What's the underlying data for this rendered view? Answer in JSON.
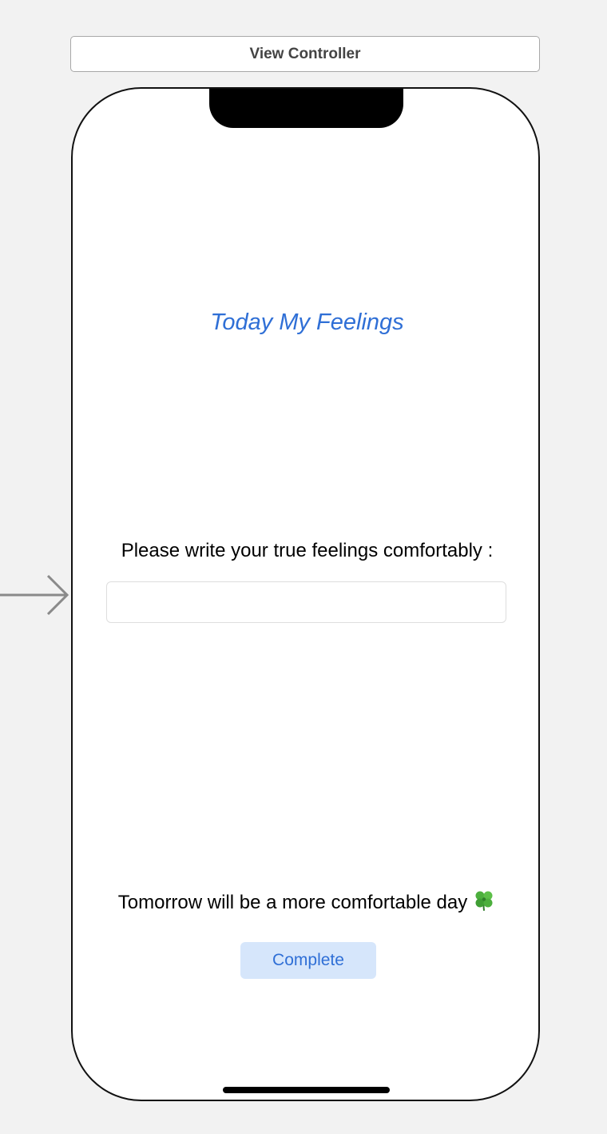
{
  "scene": {
    "title": "View Controller"
  },
  "screen": {
    "title": "Today My Feelings",
    "prompt": "Please write your true feelings comfortably :",
    "input": {
      "value": "",
      "placeholder": ""
    },
    "footer_text": "Tomorrow will be a more comfortable day",
    "footer_icon": "four-leaf-clover-icon",
    "complete_label": "Complete"
  },
  "colors": {
    "accent": "#2f6fd6",
    "button_background": "#d6e6fb",
    "canvas_background": "#f2f2f2"
  }
}
